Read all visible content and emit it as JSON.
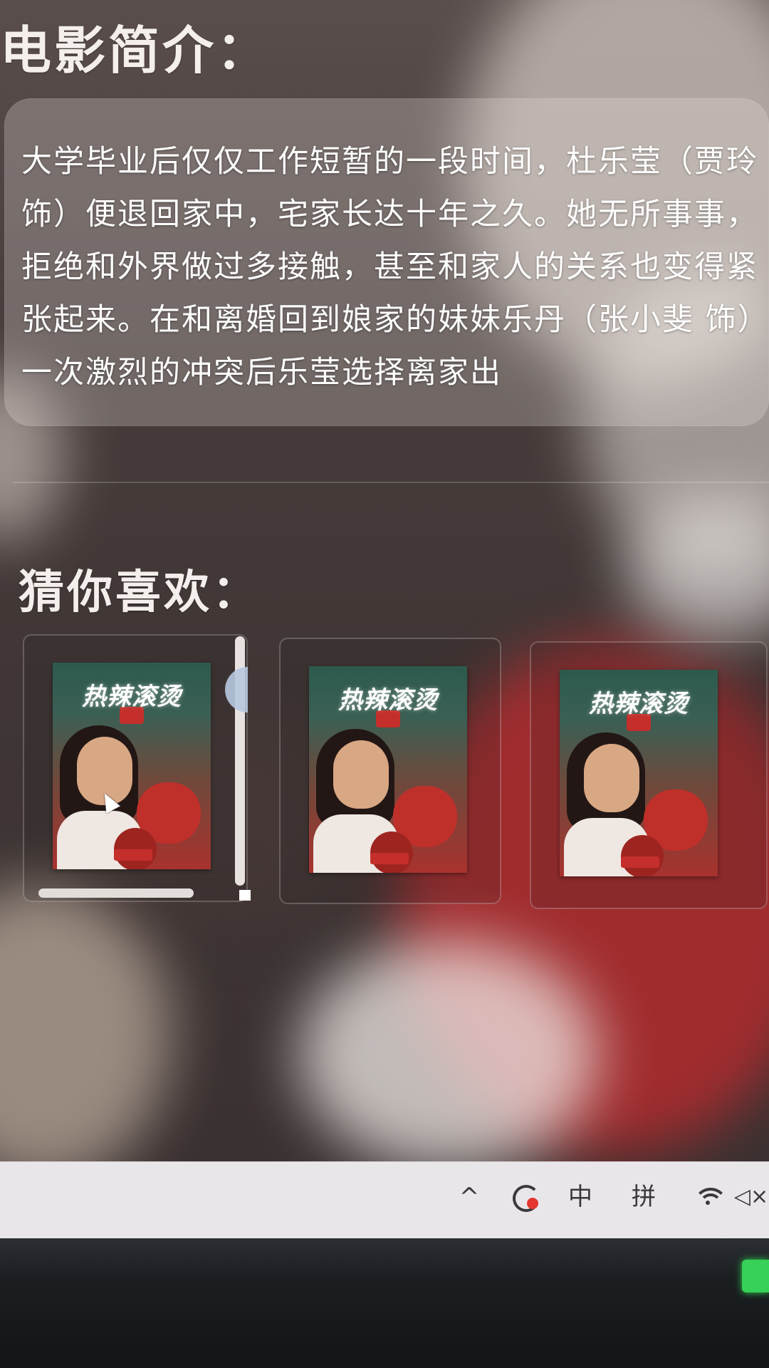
{
  "intro": {
    "title": "电影简介：",
    "synopsis": "大学毕业后仅仅工作短暂的一段时间，杜乐莹（贾玲 饰）便退回家中，宅家长达十年之久。她无所事事，拒绝和外界做过多接触，甚至和家人的关系也变得紧张起来。在和离婚回到娘家的妹妹乐丹（张小斐 饰）一次激烈的冲突后乐莹选择离家出"
  },
  "recommendations": {
    "title": "猜你喜欢：",
    "items": [
      {
        "poster_title": "热辣滚烫"
      },
      {
        "poster_title": "热辣滚烫"
      },
      {
        "poster_title": "热辣滚烫"
      }
    ]
  },
  "taskbar": {
    "chevron": "^",
    "ime_mode": "中",
    "ime_pinyin": "拼",
    "volume": "◁×"
  },
  "colors": {
    "accent_red": "#c42f2b",
    "taskbar_bg": "#e9e6ea",
    "indicator_green": "#37d058"
  },
  "icons": [
    "chevron-up-icon",
    "sync-icon",
    "wifi-icon",
    "volume-muted-icon",
    "mouse-cursor-icon"
  ]
}
